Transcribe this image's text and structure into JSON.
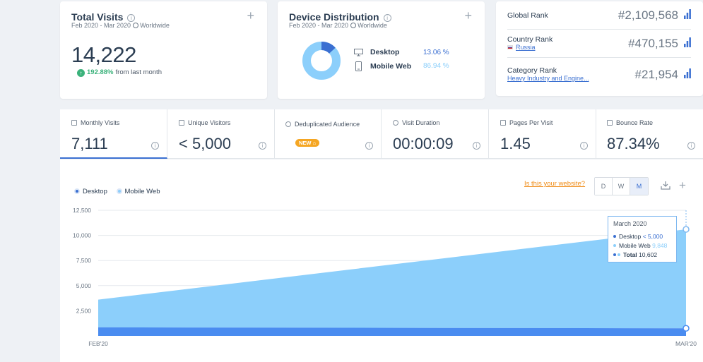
{
  "total_visits": {
    "title": "Total Visits",
    "date_range": "Feb 2020 - Mar 2020",
    "region": "Worldwide",
    "value": "14,222",
    "change_pct": "192.88%",
    "change_text": "from last month"
  },
  "device_distribution": {
    "title": "Device Distribution",
    "date_range": "Feb 2020 - Mar 2020",
    "region": "Worldwide",
    "desktop_label": "Desktop",
    "desktop_pct": "13.06 %",
    "mobile_label": "Mobile Web",
    "mobile_pct": "86.94 %",
    "desktop_share": 13.06,
    "mobile_share": 86.94,
    "desktop_color": "#3a6fd1",
    "mobile_color": "#8ccffb"
  },
  "ranks": {
    "global_label": "Global Rank",
    "global_value": "#2,109,568",
    "country_label": "Country Rank",
    "country_name": "Russia",
    "country_value": "#470,155",
    "category_label": "Category Rank",
    "category_name": "Heavy Industry and Engine...",
    "category_value": "#21,954"
  },
  "metrics": [
    {
      "label": "Monthly Visits",
      "value": "7,111"
    },
    {
      "label": "Unique Visitors",
      "value": "< 5,000"
    },
    {
      "label": "Deduplicated Audience",
      "badge": "NEW"
    },
    {
      "label": "Visit Duration",
      "value": "00:00:09"
    },
    {
      "label": "Pages Per Visit",
      "value": "1.45"
    },
    {
      "label": "Bounce Rate",
      "value": "87.34%"
    }
  ],
  "chart_controls": {
    "legend_desktop": "Desktop",
    "legend_mobile": "Mobile Web",
    "your_website_link": "Is this your website?",
    "period_d": "D",
    "period_w": "W",
    "period_m": "M",
    "selected_period": "M"
  },
  "tooltip": {
    "title": "March 2020",
    "desktop_label": "Desktop",
    "desktop_value": "< 5,000",
    "mobile_label": "Mobile Web",
    "mobile_value": "9,848",
    "total_label": "Total",
    "total_value": "10,602"
  },
  "chart_data": {
    "type": "area",
    "stacked": true,
    "x": [
      "FEB'20",
      "MAR'20"
    ],
    "series": [
      {
        "name": "Desktop",
        "values": [
          850,
          754
        ],
        "color": "#4a8cf0"
      },
      {
        "name": "Mobile Web",
        "values": [
          2760,
          9848
        ],
        "color": "#8ccffb"
      }
    ],
    "ylim": [
      0,
      12500
    ],
    "yticks": [
      2500,
      5000,
      7500,
      10000,
      12500
    ],
    "ytick_labels": [
      "2,500",
      "5,000",
      "7,500",
      "10,000",
      "12,500"
    ],
    "xtick_labels": [
      "FEB'20",
      "MAR'20"
    ],
    "grid": true,
    "legend": "top-left"
  }
}
